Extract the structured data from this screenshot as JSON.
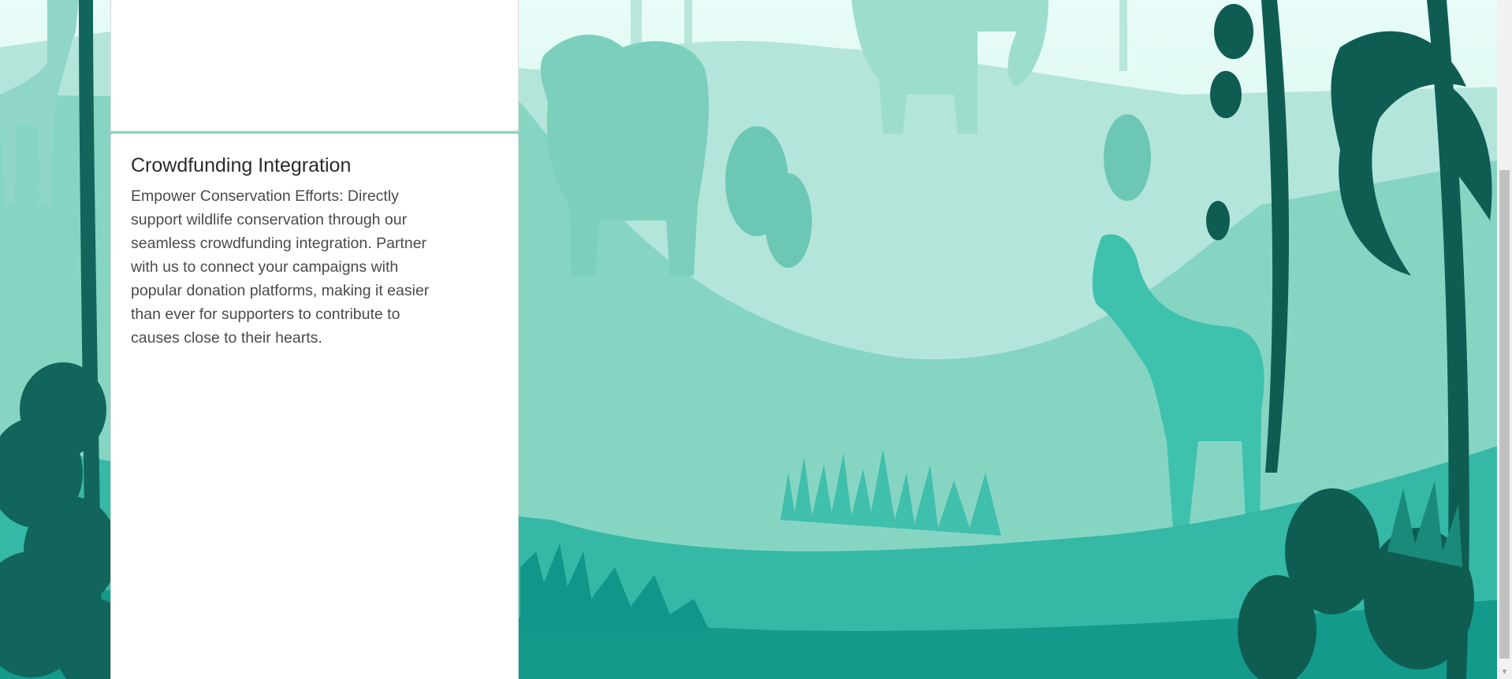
{
  "card": {
    "title": "Crowdfunding Integration",
    "description": "Empower Conservation Efforts: Directly support wildlife conservation through our seamless crowdfunding integration. Partner with us to connect your campaigns with popular donation platforms, making it easier than ever for supporters to contribute to causes close to their hearts."
  },
  "background": {
    "description_icons": [
      "elephant-silhouette",
      "zebra-silhouette",
      "palm-tree-silhouette",
      "grass-silhouette"
    ]
  },
  "colors": {
    "sky": "#e6fbf7",
    "far_hills": "#aee3d6",
    "mid_hills": "#7fd3c0",
    "near_ground": "#3dbdaa",
    "foreground": "#17a090",
    "dark_foliage": "#0f5d52",
    "card_bg": "#ffffff",
    "scrollbar_thumb": "#c1c1c1"
  },
  "scrollbar": {
    "down_arrow": "▼"
  }
}
